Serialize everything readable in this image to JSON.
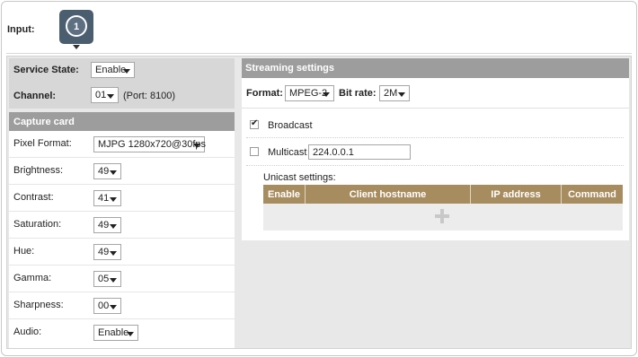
{
  "input": {
    "label": "Input:",
    "number": "1"
  },
  "service": {
    "state_label": "Service State:",
    "state_value": "Enable",
    "channel_label": "Channel:",
    "channel_value": "01",
    "port_note": "(Port: 8100)"
  },
  "capture": {
    "header": "Capture card",
    "rows": [
      {
        "label": "Pixel Format:",
        "value": "MJPG 1280x720@30fps"
      },
      {
        "label": "Brightness:",
        "value": "49"
      },
      {
        "label": "Contrast:",
        "value": "41"
      },
      {
        "label": "Saturation:",
        "value": "49"
      },
      {
        "label": "Hue:",
        "value": "49"
      },
      {
        "label": "Gamma:",
        "value": "05"
      },
      {
        "label": "Sharpness:",
        "value": "00"
      },
      {
        "label": "Audio:",
        "value": "Enable"
      }
    ]
  },
  "streaming": {
    "header": "Streaming settings",
    "format_label": "Format:",
    "format_value": "MPEG-2",
    "bitrate_label": "Bit rate:",
    "bitrate_value": "2M",
    "broadcast_label": "Broadcast",
    "broadcast_checked": true,
    "multicast_label": "Multicast",
    "multicast_checked": false,
    "multicast_address": "224.0.0.1",
    "unicast_label": "Unicast settings:",
    "unicast_columns": [
      "Enable",
      "Client hostname",
      "IP address",
      "Command"
    ]
  },
  "colors": {
    "section_header": "#9d9d9d",
    "table_header": "#a78c5f",
    "input_tile": "#4b5e70"
  }
}
